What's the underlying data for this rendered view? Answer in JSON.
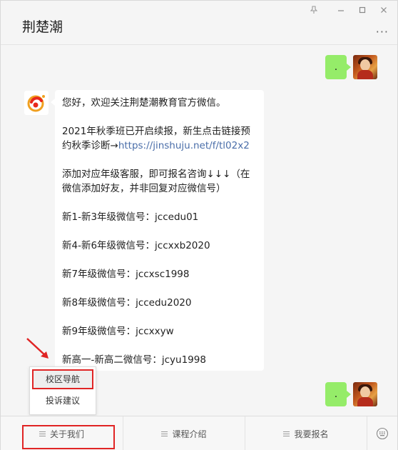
{
  "window": {
    "title": "荆楚潮"
  },
  "controls": {
    "pin": "pin-icon",
    "minimize": "minimize-icon",
    "maximize": "maximize-icon",
    "close": "close-icon",
    "more": "···"
  },
  "messages": {
    "out_1": ".",
    "out_2": ".",
    "in_1": {
      "lines": [
        "您好，欢迎关注荆楚潮教育官方微信。",
        "2021年秋季班已开启续报，新生点击链接预约秋季诊断→",
        "https://jinshuju.net/f/tl02x2",
        "添加对应年级客服，即可报名咨询↓↓↓（在微信添加好友，并非回复对应微信号）",
        "新1-新3年级微信号：jccedu01",
        "新4-新6年级微信号：jccxxb2020",
        "新7年级微信号：jccxsc1998",
        "新8年级微信号：jccedu2020",
        "新9年级微信号：jccxxyw",
        "新高一-新高二微信号：jcyu1998"
      ]
    }
  },
  "popup": {
    "items": [
      "校区导航",
      "投诉建议"
    ]
  },
  "menu": {
    "items": [
      "关于我们",
      "课程介绍",
      "我要报名"
    ],
    "keyboard_icon": "keyboard-icon"
  },
  "colors": {
    "bubble_out": "#95ec69",
    "highlight": "#e02424",
    "link": "#4a6ea9"
  }
}
